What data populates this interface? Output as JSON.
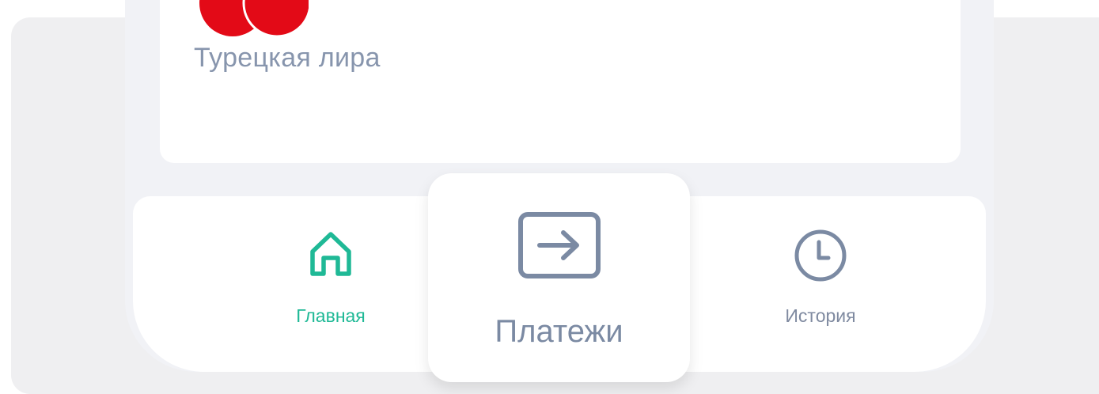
{
  "colors": {
    "accent": "#1fb996",
    "icon_muted": "#7b8aa3",
    "flag_red": "#e30a17"
  },
  "currency_card": {
    "name": "Турецкая лира",
    "flag_icon": "turkey-flag-icon"
  },
  "bottom_nav": {
    "active": "home",
    "items": [
      {
        "id": "home",
        "label": "Главная",
        "icon": "home-icon"
      },
      {
        "id": "payments",
        "label": "Платежи",
        "icon": "transfer-arrow-icon"
      },
      {
        "id": "history",
        "label": "История",
        "icon": "clock-icon"
      }
    ]
  }
}
